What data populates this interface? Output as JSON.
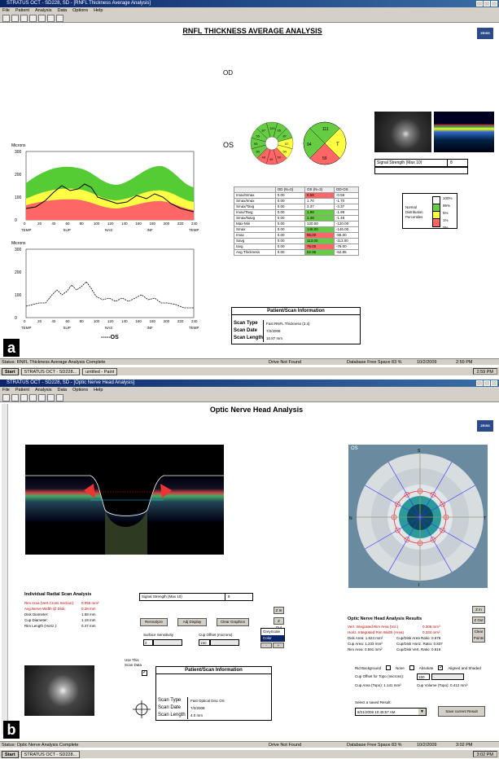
{
  "panel_a": {
    "label": "a",
    "window_title": "STRATUS OCT - SD228, SD - [RNFL Thickness Average Analysis]",
    "menu": [
      "File",
      "Patient",
      "Analysis",
      "Data",
      "Options",
      "Help"
    ],
    "page_title": "RNFL THICKNESS AVERAGE ANALYSIS",
    "zeiss": "ZEISS",
    "eye_od": "OD",
    "eye_os": "OS",
    "chart1": {
      "ylabel": "Microns",
      "yticks": [
        "300",
        "200",
        "100",
        "0"
      ],
      "xticks": [
        "0",
        "20",
        "40",
        "60",
        "80",
        "100",
        "120",
        "140",
        "160",
        "180",
        "200",
        "220",
        "240"
      ],
      "xregions": [
        "TEMP",
        "SUP",
        "NAS",
        "INF",
        "TEMP"
      ]
    },
    "chart2": {
      "ylabel": "Microns",
      "yticks": [
        "300",
        "200",
        "100",
        "0"
      ],
      "xticks": [
        "0",
        "20",
        "40",
        "60",
        "80",
        "100",
        "120",
        "140",
        "160",
        "180",
        "200",
        "220",
        "240"
      ],
      "xregions": [
        "TEMP",
        "SUP",
        "NAS",
        "INF",
        "TEMP"
      ],
      "legend": "-----OS"
    },
    "clock_od": [
      "120",
      "95",
      "87",
      "57",
      "54",
      "50",
      "49",
      "48",
      "80",
      "95",
      "55",
      "87"
    ],
    "sector_os": [
      "111",
      "T",
      "59",
      "94"
    ],
    "signal_strength_label": "Signal Strength (Max 10)",
    "signal_strength_value": "8",
    "table": {
      "headers": [
        "",
        "OD (N=0)",
        "OS (N=3)",
        "OD-OS"
      ],
      "rows": [
        [
          "Imax/Smax",
          "0.00",
          "0.59",
          "-0.59"
        ],
        [
          "Smax/Imax",
          "0.00",
          "1.70",
          "-1.70"
        ],
        [
          "Smax/Tavg",
          "0.00",
          "3.37",
          "-3.37"
        ],
        [
          "Imax/Tavg",
          "0.00",
          "1.99",
          "-1.99"
        ],
        [
          "Smax/Navg",
          "0.00",
          "1.48",
          "-1.48"
        ],
        [
          "Max-Min",
          "0.00",
          "120.00",
          "-120.00"
        ],
        [
          "Smax",
          "0.00",
          "146.00",
          "-146.00"
        ],
        [
          "Imax",
          "0.00",
          "86.00",
          "-86.00"
        ],
        [
          "Savg",
          "0.00",
          "113.00",
          "-113.00"
        ],
        [
          "Iavg",
          "0.00",
          "76.00",
          "-76.00"
        ],
        [
          "Avg.Thickness",
          "0.00",
          "62.85",
          "-62.85"
        ]
      ],
      "os_colors": [
        "#ff6666",
        "#ffffff",
        "#ffffff",
        "#66cc44",
        "#66cc44",
        "#ffffff",
        "#66cc44",
        "#ff6666",
        "#66cc44",
        "#ff6666",
        "#66cc44"
      ]
    },
    "legend": {
      "title": "Normal Distribution Percentiles",
      "items": [
        "100%",
        "95%",
        "5%",
        "1%",
        "0%"
      ],
      "colors": [
        "#ffffff",
        "#66cc44",
        "#ffff44",
        "#ff6666"
      ]
    },
    "patient_info": {
      "title": "Patient/Scan Information",
      "scan_type_label": "Scan Type",
      "scan_type": "Fast RNFL Thickness (3.4)",
      "scan_date_label": "Scan Date",
      "scan_date": "7/2/2008",
      "scan_length_label": "Scan Length",
      "scan_length": "10.87 mm"
    },
    "status": "Status: RNFL Thickness Average Analysis Complete",
    "status_drive": "Drive Not Found",
    "status_db": "Database Free Space 83 %",
    "status_date": "10/2/2009",
    "status_time": "2:59 PM",
    "taskbar": {
      "start": "Start",
      "items": [
        "STRATUS OCT - SD228...",
        "untitled - Paint"
      ],
      "time": "2:59 PM"
    }
  },
  "panel_b": {
    "label": "b",
    "window_title": "STRATUS OCT - SD228, SD - [Optic Nerve Head Analysis]",
    "menu": [
      "File",
      "Patient",
      "Analysis",
      "Data",
      "Options",
      "Help"
    ],
    "page_title": "Optic Nerve Head Analysis",
    "zeiss": "ZEISS",
    "os_label": "OS",
    "compass": {
      "s": "S",
      "n": "N",
      "t": "T",
      "i": "I"
    },
    "irsa": {
      "title": "Individual Radial Scan Analysis",
      "rows": [
        [
          "Rim Area (Vert.Cross Section):",
          "0.055 mm²"
        ],
        [
          "Avg.Nerve Width @ Disk:",
          "0.28 mm"
        ],
        [
          "Disk Diameter:",
          "1.58 mm"
        ],
        [
          "Cup Diameter:",
          "1.19 mm"
        ],
        [
          "Rim Length (Horiz.):",
          "0.47 mm"
        ]
      ]
    },
    "signal_strength_label": "Signal Strength (Max 10)",
    "signal_strength_value": "8",
    "buttons": {
      "reanalyze": "ReAnalyze",
      "adj_display": "Adj Display",
      "clear_graphics": "Clear Graphics",
      "z_in": "Z In",
      "z_out": "Z Out",
      "clear_points": "Clear Points",
      "save_result": "Save current Result"
    },
    "surface_sensitivity": {
      "label": "Surface Sensitivity",
      "value": "2"
    },
    "cup_offset": {
      "label": "Cup Offset (microns):",
      "value": "150"
    },
    "greyscale": [
      "GreyScale",
      "Color"
    ],
    "use_scan": {
      "label": "Use This Scan Data"
    },
    "onh": {
      "title": "Optic Nerve Head Analysis Results",
      "rows": [
        [
          "Vert. Integrated Rim Area (Vol.)",
          "0.306 mm³"
        ],
        [
          "Horiz. Integrated Rim Width (Area)",
          "0.334 mm²"
        ],
        [
          "Disk Area: 1.524 mm²",
          "Cup/Disk Area Ratio: 0.676"
        ],
        [
          "Cup Area: 1.233 mm²",
          "Cup/Disk Horiz. Ratio: 0.837"
        ],
        [
          "Rim Area: 0.591 mm²",
          "Cup/Disk Vert. Ratio: 0.819"
        ]
      ]
    },
    "rim_bg": {
      "label": "Rid Background",
      "none": "None",
      "absolute": "Absolute",
      "aligned": "Aligned and Shaded"
    },
    "cup_offset_topo": {
      "label": "Cup Offset for Topo (microns):",
      "value": "150"
    },
    "cup_area_topo": "Cup Area (Topo): 1.141 mm²",
    "cup_volume_topo": "Cup Volume (Topo): 0.412 mm³",
    "saved_result": {
      "label": "Select a saved Result:",
      "value": "8/21/2008 10:45:57 AM"
    },
    "patient_info": {
      "title": "Patient/Scan Information",
      "scan_type_label": "Scan Type",
      "scan_type": "Fast Optical Disc OS",
      "scan_date_label": "Scan Date",
      "scan_date": "7/2/2008",
      "scan_length_label": "Scan Length",
      "scan_length": "4.0 mm"
    },
    "status": "Status: Optic Nerve Analysis Complete",
    "status_drive": "Drive Not Found",
    "status_db": "Database Free Space 83 %",
    "status_date": "10/2/2009",
    "status_time": "3:02 PM",
    "taskbar": {
      "start": "Start",
      "items": [
        "STRATUS OCT - SD228..."
      ],
      "time": "3:02 PM"
    }
  }
}
